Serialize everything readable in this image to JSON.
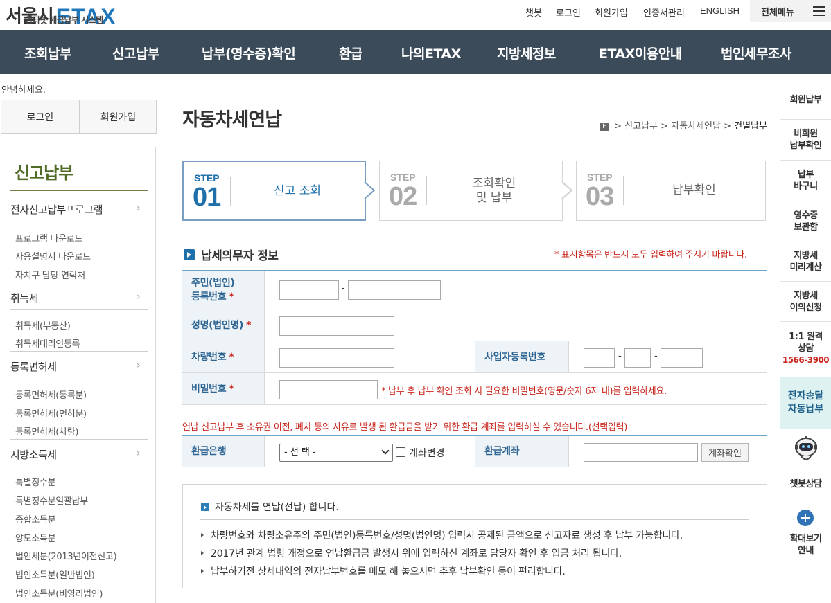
{
  "header": {
    "logo_city": "서울시",
    "logo_etax": "ETAX",
    "logo_sub": "인터넷 세금납부 시스템",
    "util": [
      "챗봇",
      "로그인",
      "회원가입",
      "인증서관리",
      "ENGLISH"
    ],
    "all_menu": "전체메뉴"
  },
  "gnb": [
    "조회납부",
    "신고납부",
    "납부(영수증)확인",
    "환급",
    "나의ETAX",
    "지방세정보",
    "ETAX이용안내",
    "법인세무조사"
  ],
  "sidebar": {
    "greeting": "안녕하세요.",
    "login": "로그인",
    "join": "회원가입",
    "title": "신고납부",
    "categories": [
      {
        "label": "전자신고납부프로그램",
        "items": [
          "프로그램 다운로드",
          "사용설명서 다운로드",
          "자치구 담당 연락처"
        ]
      },
      {
        "label": "취득세",
        "items": [
          "취득세(부동산)",
          "취득세대리인등록"
        ]
      },
      {
        "label": "등록면허세",
        "items": [
          "등록면허세(등록분)",
          "등록면허세(면허분)",
          "등록면허세(차량)"
        ]
      },
      {
        "label": "지방소득세",
        "items": [
          "특별징수분",
          "특별징수분일괄납부",
          "종합소득분",
          "양도소득분",
          "법인세분(2013년이전신고)",
          "법인소득분(일반법인)",
          "법인소득분(비영리법인)"
        ]
      }
    ]
  },
  "page": {
    "title": "자동차세연납",
    "breadcrumb": [
      "H",
      "신고납부",
      "자동차세연납",
      "건별납부"
    ]
  },
  "steps": [
    {
      "word": "STEP",
      "num": "01",
      "label": "신고 조회",
      "active": true
    },
    {
      "word": "STEP",
      "num": "02",
      "label_line1": "조회확인",
      "label_line2": "및 납부",
      "active": false
    },
    {
      "word": "STEP",
      "num": "03",
      "label": "납부확인",
      "active": false
    }
  ],
  "section": {
    "title": "납세의무자 정보",
    "required_note": "* 표시항목은 반드시 모두 입력하여 주시기 바랍니다."
  },
  "form": {
    "rrn_label_1": "주민(법인)",
    "rrn_label_2": "등록번호",
    "name_label": "성명(법인명)",
    "car_label": "차량번호",
    "biz_label": "사업자등록번호",
    "pw_label": "비밀번호",
    "star": "*",
    "dash": "-",
    "pw_note": "* 납부 후 납부 확인 조회 시 필요한 비밀번호(영문/숫자 6자 내)를 입력하세요.",
    "rrn1_value": "",
    "rrn2_value": "",
    "name_value": "",
    "car_value": "",
    "biz1_value": "",
    "biz2_value": "",
    "biz3_value": "",
    "pw_value": ""
  },
  "refund": {
    "message": "연납 신고납부 후 소유권 이전, 폐차 등의 사유로 발생 된 환급금을 받기 위한 환급 계좌를 입력하실 수 있습니다.(선택입력)",
    "bank_label": "환급은행",
    "bank_selected": "- 선 택 -",
    "account_change": "계좌변경",
    "account_label": "환급계좌",
    "account_value": "",
    "check_button": "계좌확인"
  },
  "info": {
    "head": "자동차세를 연납(선납) 합니다.",
    "items": [
      "차량번호와 차량소유주의 주민(법인)등록번호/성명(법인명) 입력시 공제된 금액으로 신고자료 생성 후 납부 가능합니다.",
      "2017년 관계 법령 개정으로 연납환급금 발생시 위에 입력하신 계좌로 담당자 확인 후 입금 처리 됩니다.",
      "납부하기전 상세내역의 전자납부번호를 메모 해 놓으시면 추후 납부확인 등이 편리합니다."
    ]
  },
  "quick": {
    "items": [
      {
        "l1": "회원납부"
      },
      {
        "l1": "비회원",
        "l2": "납부확인"
      },
      {
        "l1": "납부",
        "l2": "바구니"
      },
      {
        "l1": "영수증",
        "l2": "보관함"
      },
      {
        "l1": "지방세",
        "l2": "미리계산"
      },
      {
        "l1": "지방세",
        "l2": "이의신청"
      }
    ],
    "consult_l1": "1:1 원격",
    "consult_l2": "상담",
    "consult_tel": "1566-3900",
    "etr_l1": "전자송달",
    "etr_l2": "자동납부",
    "chatbot": "챗봇상담",
    "zoom_l1": "확대보기",
    "zoom_l2": "안내"
  },
  "colors": {
    "gnb_bg": "#3b4b5a",
    "brand": "#1f76b9",
    "accent_green": "#4f6b24",
    "required_red": "#c8261d",
    "th_bg": "#edf3f7"
  }
}
